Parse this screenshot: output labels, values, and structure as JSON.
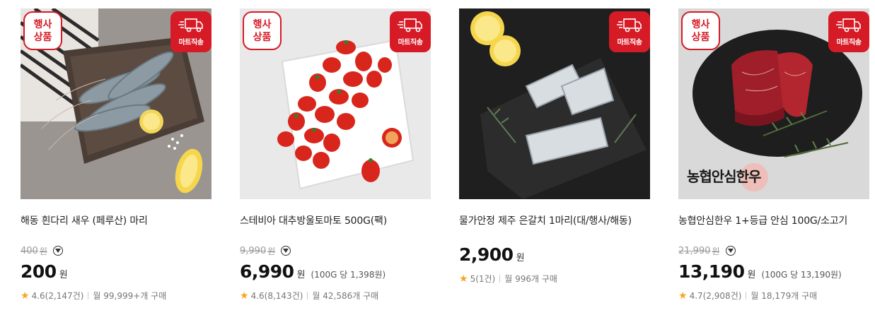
{
  "colors": {
    "accent_red": "#d71b26",
    "star": "#f5a623"
  },
  "products": [
    {
      "image": "shrimp-on-plate",
      "event_badge": "행사 상품",
      "delivery_badge": "마트직송",
      "title": "해동 흰다리 새우 (페루산) 마리",
      "original_price": "400",
      "original_unit": "원",
      "price": "200",
      "price_unit": "원",
      "unit_price": "",
      "rating": "4.6",
      "review_count": "(2,147건)",
      "monthly_sales": "월 99,999+개 구매"
    },
    {
      "image": "cherry-tomatoes-on-plate",
      "event_badge": "행사 상품",
      "delivery_badge": "마트직송",
      "title": "스테비아 대추방울토마토 500G(팩)",
      "original_price": "9,990",
      "original_unit": "원",
      "price": "6,990",
      "price_unit": "원",
      "unit_price": "(100G 당 1,398원)",
      "rating": "4.6",
      "review_count": "(8,143건)",
      "monthly_sales": "월 42,586개 구매"
    },
    {
      "image": "hairtail-fish-on-slate",
      "event_badge": "",
      "delivery_badge": "마트직송",
      "title": "물가안정 제주 은갈치 1마리(대/행사/해동)",
      "original_price": "",
      "original_unit": "",
      "price": "2,900",
      "price_unit": "원",
      "unit_price": "",
      "rating": "5",
      "review_count": "(1건)",
      "monthly_sales": "월 996개 구매"
    },
    {
      "image": "hanwoo-beef-tenderloin",
      "event_badge": "행사 상품",
      "delivery_badge": "마트직송",
      "logo_text": "농협안심한우",
      "title": "농협안심한우 1+등급 안심 100G/소고기",
      "original_price": "21,990",
      "original_unit": "원",
      "price": "13,190",
      "price_unit": "원",
      "unit_price": "(100G 당 13,190원)",
      "rating": "4.7",
      "review_count": "(2,908건)",
      "monthly_sales": "월 18,179개 구매"
    }
  ]
}
